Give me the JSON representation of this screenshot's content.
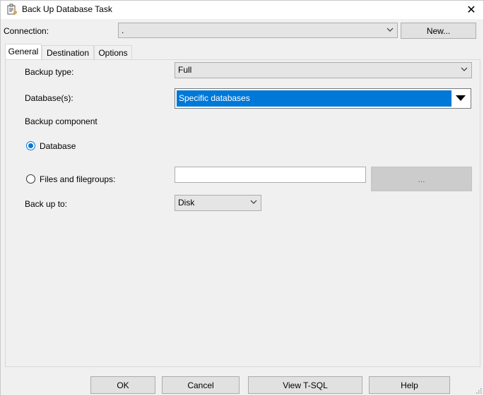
{
  "window": {
    "title": "Back Up Database Task",
    "close_glyph": "✕",
    "icon": "task-icon"
  },
  "connection": {
    "label": "Connection:",
    "value": ".",
    "new_button": "New..."
  },
  "tabs": [
    {
      "label": "General",
      "active": true
    },
    {
      "label": "Destination",
      "active": false
    },
    {
      "label": "Options",
      "active": false
    }
  ],
  "general": {
    "backup_type_label": "Backup type:",
    "backup_type_value": "Full",
    "databases_label": "Database(s):",
    "databases_value": "Specific databases",
    "backup_component_label": "Backup component",
    "radio_database_label": "Database",
    "radio_database_checked": true,
    "radio_files_label": "Files and filegroups:",
    "radio_files_checked": false,
    "files_value": "",
    "browse_label": "...",
    "backup_to_label": "Back up to:",
    "backup_to_value": "Disk"
  },
  "footer": {
    "ok": "OK",
    "cancel": "Cancel",
    "view_tsql": "View T-SQL",
    "help": "Help"
  },
  "colors": {
    "accent": "#0078d7",
    "window_bg": "#f0f0f0"
  }
}
